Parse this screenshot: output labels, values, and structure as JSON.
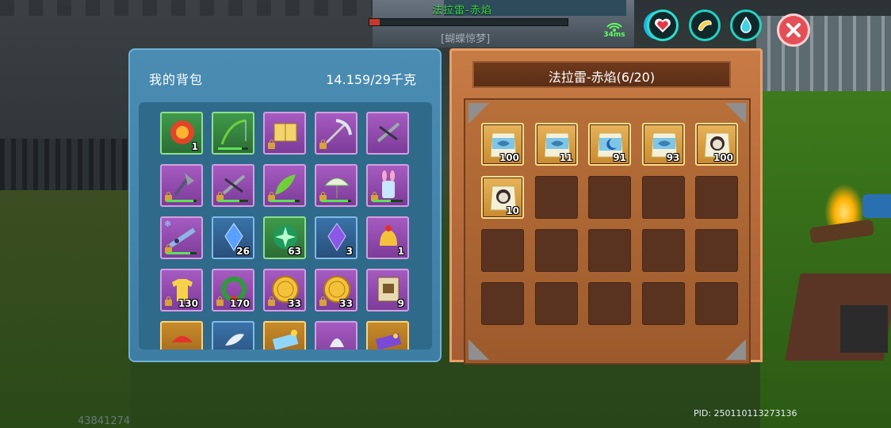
{
  "hud": {
    "target_name": "法拉雷-赤焰",
    "target_subtitle": "[蝴蝶惊梦]",
    "target_hp_fraction": 0.05,
    "ping": "34ms",
    "pid": "PID: 250110113273136",
    "uid": "43841274",
    "buttons": [
      "heart-icon",
      "food-icon",
      "water-drop-icon",
      "close-icon"
    ]
  },
  "backpack": {
    "title": "我的背包",
    "weight": "14.159/29千克",
    "slots": [
      {
        "icon": "red-orb-item-icon",
        "rarity": "green",
        "qty": "1"
      },
      {
        "icon": "fishing-rod-icon",
        "rarity": "green",
        "durability": 0.8
      },
      {
        "icon": "book-icon",
        "rarity": "purple",
        "locked": true
      },
      {
        "icon": "pickaxe-icon",
        "rarity": "purple",
        "locked": true
      },
      {
        "icon": "crossbow-icon",
        "rarity": "purple"
      },
      {
        "icon": "battle-axe-icon",
        "rarity": "purple",
        "locked": true,
        "durability": 0.9
      },
      {
        "icon": "crossbow-icon",
        "rarity": "purple",
        "locked": true,
        "durability": 0.7
      },
      {
        "icon": "green-leaf-blade-icon",
        "rarity": "purple",
        "locked": true,
        "durability": 0.85
      },
      {
        "icon": "paper-umbrella-icon",
        "rarity": "purple",
        "locked": true,
        "durability": 0.9
      },
      {
        "icon": "bunny-drink-icon",
        "rarity": "purple",
        "locked": true,
        "durability": 0.6
      },
      {
        "icon": "ice-gun-icon",
        "rarity": "purple",
        "locked": true,
        "frozen": true,
        "durability": 0.8
      },
      {
        "icon": "blue-crystal-icon",
        "rarity": "blue",
        "qty": "26"
      },
      {
        "icon": "green-star-gem-icon",
        "rarity": "green",
        "qty": "63"
      },
      {
        "icon": "purple-crystal-icon",
        "rarity": "blue",
        "qty": "3"
      },
      {
        "icon": "christmas-bell-icon",
        "rarity": "purple",
        "qty": "1"
      },
      {
        "icon": "yellow-shirt-icon",
        "rarity": "purple",
        "locked": true,
        "qty": "130"
      },
      {
        "icon": "christmas-wreath-icon",
        "rarity": "purple",
        "locked": true,
        "qty": "170"
      },
      {
        "icon": "gold-coin-icon",
        "rarity": "purple",
        "locked": true,
        "qty": "33"
      },
      {
        "icon": "gold-coin-icon",
        "rarity": "purple",
        "locked": true,
        "qty": "33"
      },
      {
        "icon": "wanted-poster-icon",
        "rarity": "purple",
        "qty": "9"
      },
      {
        "icon": "red-item-icon",
        "rarity": "gold"
      },
      {
        "icon": "feather-icon",
        "rarity": "blue"
      },
      {
        "icon": "gift-card-icon",
        "rarity": "gold"
      },
      {
        "icon": "white-item-icon",
        "rarity": "purple"
      },
      {
        "icon": "purple-card-icon",
        "rarity": "gold"
      }
    ]
  },
  "chest": {
    "title": "法拉雷-赤焰(6/20)",
    "slots": [
      {
        "icon": "fish-feed-bag-icon",
        "qty": "100"
      },
      {
        "icon": "fish-feed-bag-icon",
        "qty": "11"
      },
      {
        "icon": "blue-moon-bag-icon",
        "qty": "91"
      },
      {
        "icon": "fish-feed-bag-icon",
        "qty": "93"
      },
      {
        "icon": "creature-feed-bag-icon",
        "qty": "100"
      },
      {
        "icon": "creature-feed-bag-icon",
        "qty": "10"
      },
      {},
      {},
      {},
      {},
      {},
      {},
      {},
      {},
      {},
      {},
      {},
      {},
      {},
      {}
    ]
  }
}
